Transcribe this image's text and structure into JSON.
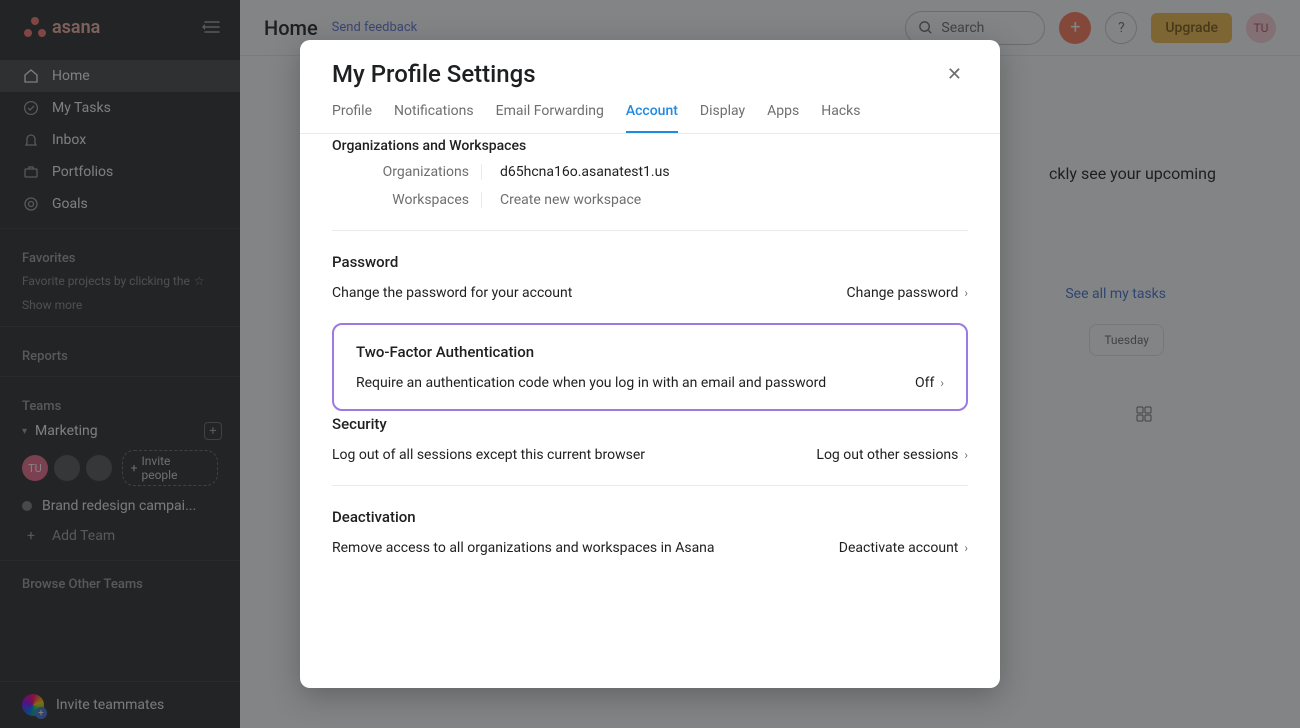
{
  "brand": {
    "name": "asana"
  },
  "sidebar": {
    "nav": [
      {
        "label": "Home"
      },
      {
        "label": "My Tasks"
      },
      {
        "label": "Inbox"
      },
      {
        "label": "Portfolios"
      },
      {
        "label": "Goals"
      }
    ],
    "favorites": {
      "heading": "Favorites",
      "hint": "Favorite projects by clicking the",
      "show_more": "Show more"
    },
    "reports_heading": "Reports",
    "teams": {
      "heading": "Teams",
      "team_name": "Marketing",
      "invite_label": "Invite people",
      "project_name": "Brand redesign campai...",
      "add_team": "Add Team",
      "browse_other": "Browse Other Teams"
    },
    "footer": {
      "invite_teammates": "Invite teammates"
    }
  },
  "main": {
    "title": "Home",
    "send_feedback": "Send feedback",
    "search_placeholder": "Search",
    "upgrade": "Upgrade",
    "user_initials": "TU",
    "bg_hint": "ckly see your upcoming",
    "see_all_tasks": "See all my tasks",
    "tuesday": "Tuesday"
  },
  "modal": {
    "title": "My Profile Settings",
    "tabs": {
      "profile": "Profile",
      "notifications": "Notifications",
      "email_forwarding": "Email Forwarding",
      "account": "Account",
      "display": "Display",
      "apps": "Apps",
      "hacks": "Hacks"
    },
    "orgs": {
      "heading": "Organizations and Workspaces",
      "org_label": "Organizations",
      "org_value": "d65hcna16o.asanatest1.us",
      "ws_label": "Workspaces",
      "ws_action": "Create new workspace"
    },
    "password": {
      "heading": "Password",
      "desc": "Change the password for your account",
      "action": "Change password"
    },
    "tfa": {
      "heading": "Two-Factor Authentication",
      "desc": "Require an authentication code when you log in with an email and password",
      "action": "Off"
    },
    "security": {
      "heading": "Security",
      "desc": "Log out of all sessions except this current browser",
      "action": "Log out other sessions"
    },
    "deactivation": {
      "heading": "Deactivation",
      "desc": "Remove access to all organizations and workspaces in Asana",
      "action": "Deactivate account"
    }
  }
}
